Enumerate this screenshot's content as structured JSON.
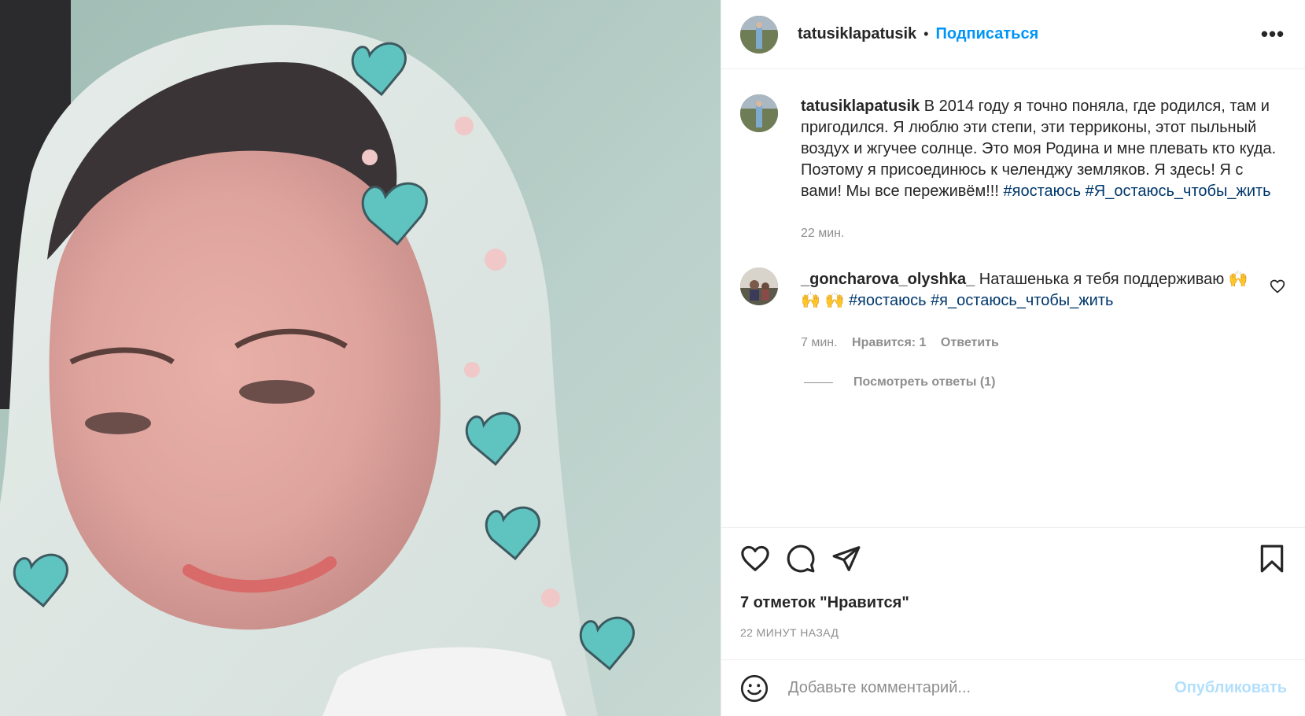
{
  "photo": {
    "icon": "post-photo"
  },
  "header": {
    "username": "tatusiklapatusik",
    "separator": "•",
    "follow_label": "Подписаться",
    "more_label": "•••"
  },
  "caption": {
    "username": "tatusiklapatusik",
    "text": "В 2014 году я точно поняла, где родился, там и пригодился. Я люблю эти степи, эти терриконы, этот пыльный воздух и жгучее солнце. Это моя Родина и мне плевать кто куда. Поэтому я присоединюсь к челенджу земляков. Я здесь! Я с вами! Мы все переживём!!!",
    "hashtag1": "#яостаюсь",
    "hashtag2": "#Я_остаюсь_чтобы_жить",
    "time": "22 мин."
  },
  "comment": {
    "username": "_goncharova_olyshka_",
    "text": "Наташенька я тебя поддерживаю 🙌 🙌 🙌",
    "hashtag1": "#яостаюсь",
    "hashtag2": "#я_остаюсь_чтобы_жить",
    "time": "7 мин.",
    "likes": "Нравится: 1",
    "reply": "Ответить",
    "view_replies": "Посмотреть ответы (1)"
  },
  "footer": {
    "likes": "7 отметок \"Нравится\"",
    "time": "22 МИНУТ НАЗАД"
  },
  "add_comment": {
    "placeholder": "Добавьте комментарий...",
    "publish": "Опубликовать"
  },
  "colors": {
    "accent": "#0095f6",
    "hashtag": "#00376b",
    "muted": "#8e8e8e",
    "publish_disabled": "#b2dffc"
  }
}
